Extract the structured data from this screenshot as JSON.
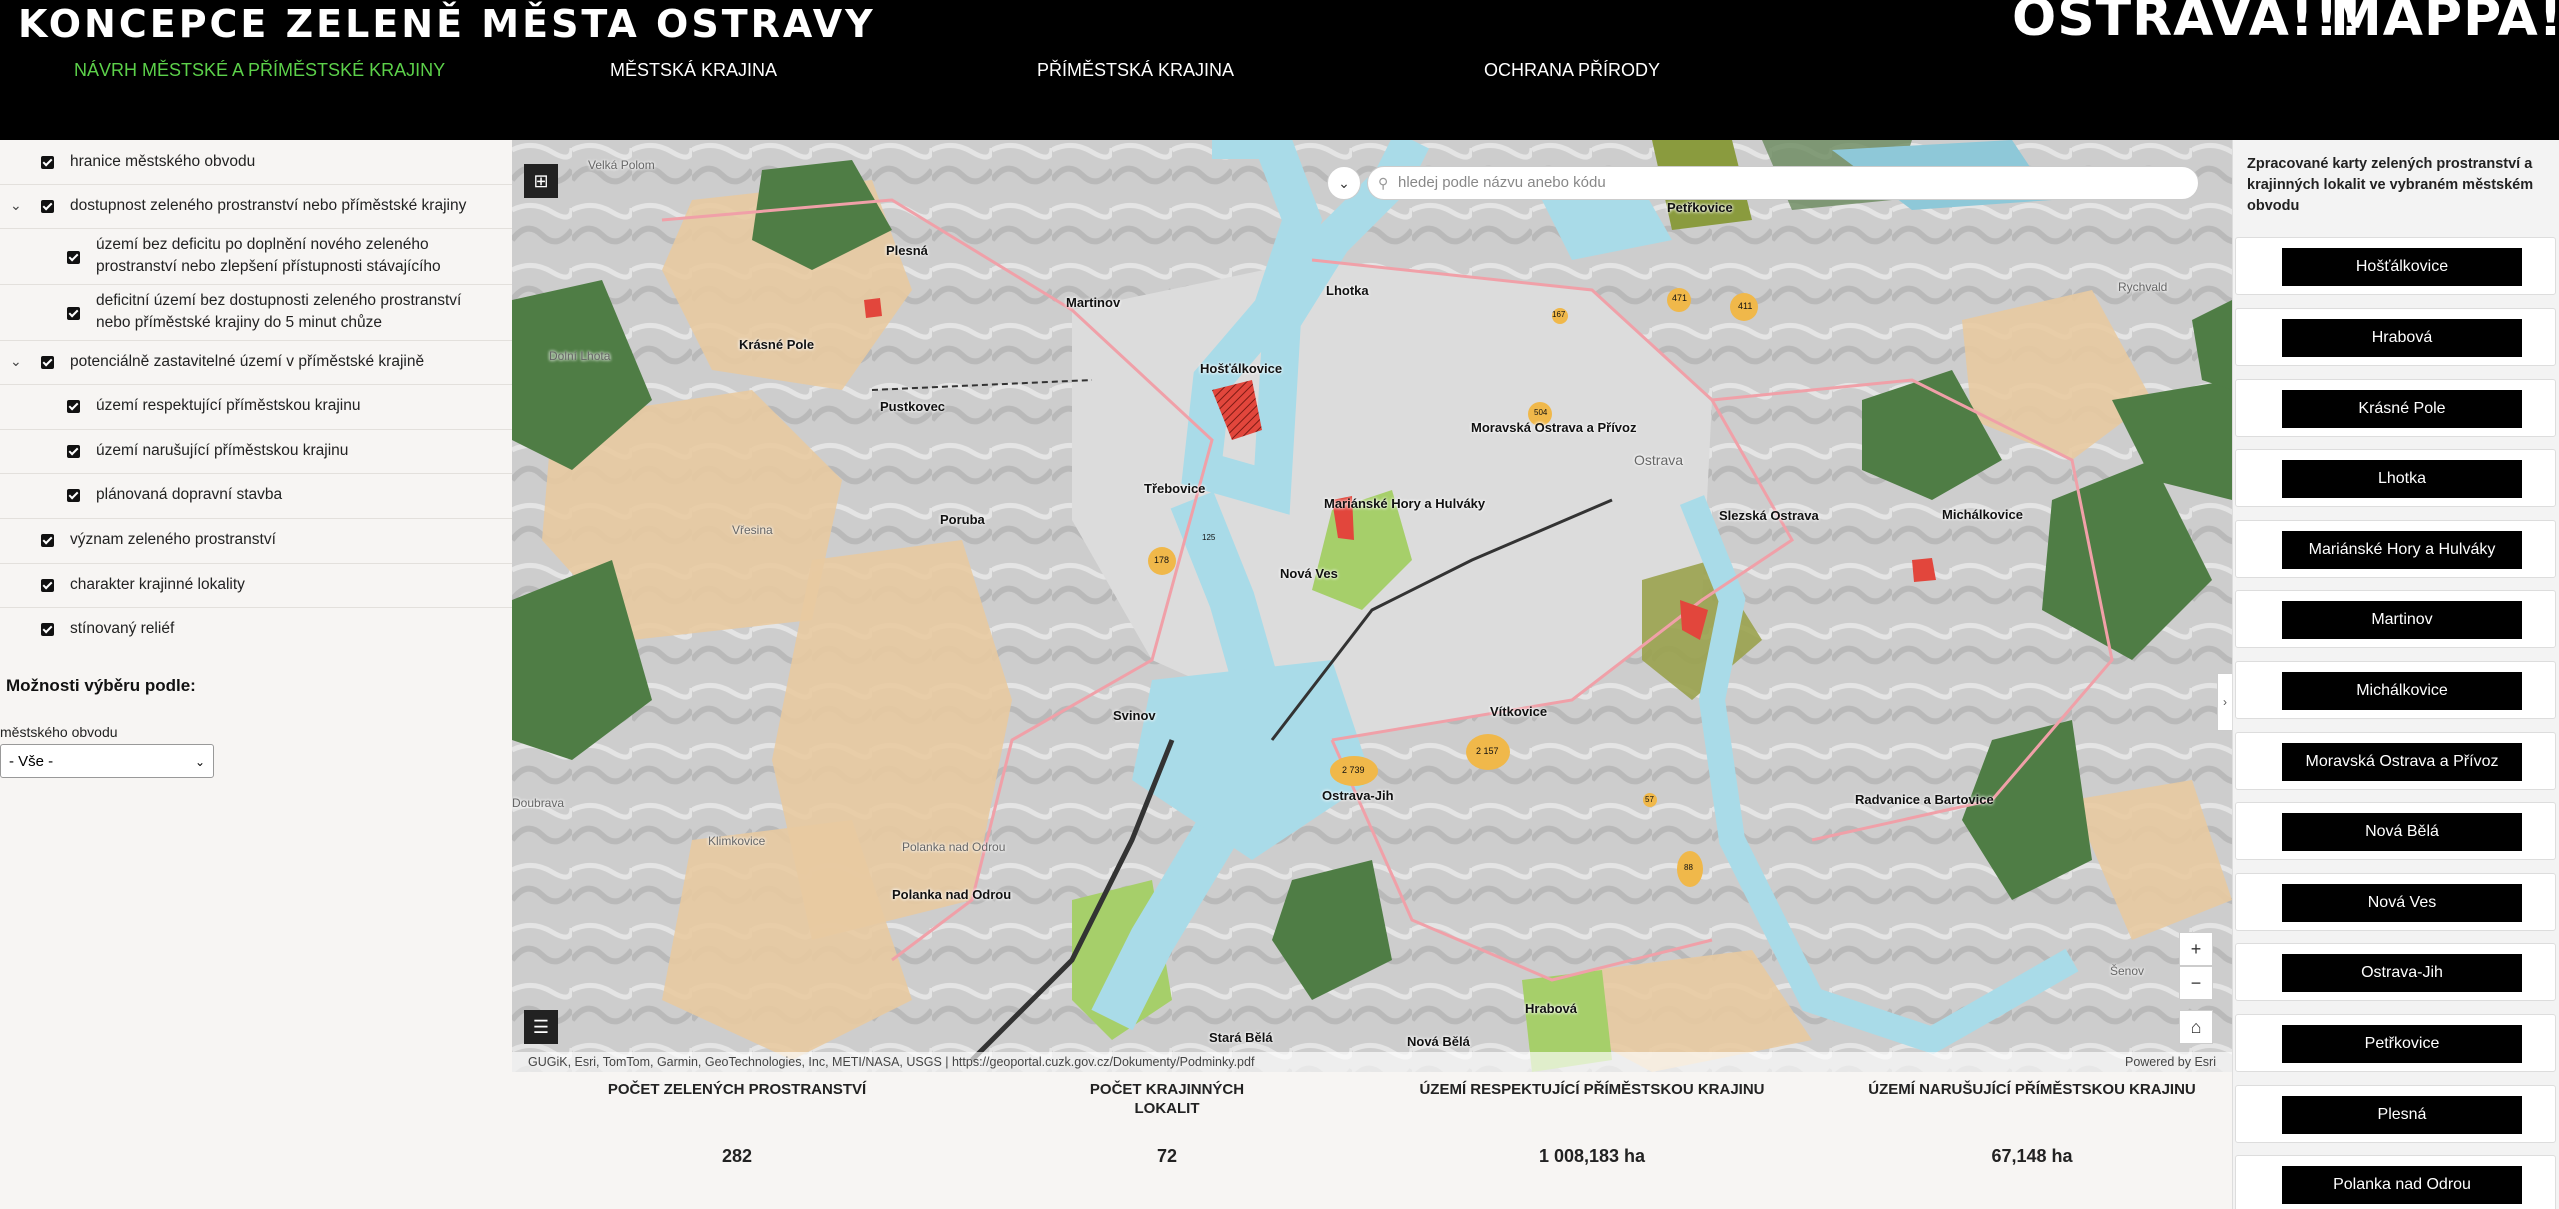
{
  "header": {
    "title": "KONCEPCE ZELENĚ MĚSTA OSTRAVY",
    "brand_1": "OSTRAVA!!!",
    "brand_2": "MAPPA!!!",
    "nav": [
      {
        "label": "NÁVRH MĚSTSKÉ A PŘÍMĚSTSKÉ KRAJINY",
        "active": true
      },
      {
        "label": "MĚSTSKÁ KRAJINA"
      },
      {
        "label": "PŘÍMĚSTSKÁ KRAJINA"
      },
      {
        "label": "OCHRANA PŘÍRODY"
      }
    ]
  },
  "layers": [
    {
      "label": "hranice městského obvodu",
      "checked": true
    },
    {
      "label": "dostupnost zeleného prostranství nebo příměstské krajiny",
      "checked": true,
      "expandable": true
    },
    {
      "label_1": "území bez deficitu po doplnění nového zeleného",
      "label_2": "prostranství nebo zlepšení přístupnosti stávajícího",
      "checked": true
    },
    {
      "label_1": "deficitní území bez dostupnosti zeleného prostranství",
      "label_2": "nebo příměstské krajiny do 5 minut chůze",
      "checked": true
    },
    {
      "label": "potenciálně zastavitelné území v příměstské krajině",
      "checked": true,
      "expandable": true
    },
    {
      "label": "území respektující příměstskou krajinu",
      "checked": true
    },
    {
      "label": "území narušující příměstskou krajinu",
      "checked": true
    },
    {
      "label": "plánovaná dopravní stavba",
      "checked": true
    },
    {
      "label": "význam zeleného prostranství",
      "checked": true
    },
    {
      "label": "charakter krajinné lokality",
      "checked": true
    },
    {
      "label": "stínovaný reliéf",
      "checked": true
    }
  ],
  "filter": {
    "title": "Možnosti výběru podle:",
    "sublabel": "městského obvodu",
    "selected": "- Vše -"
  },
  "map": {
    "search_placeholder": "hledej podle názvu anebo kódu",
    "attribution_left": "GUGiK, Esri, TomTom, Garmin, GeoTechnologies, Inc, METI/NASA, USGS | https://geoportal.cuzk.gov.cz/Dokumenty/Podminky.pdf",
    "attribution_right": "Powered by Esri",
    "labels": [
      "Petřkovice",
      "Plesná",
      "Martinov",
      "Lhotka",
      "Krásné Pole",
      "Hošťálkovice",
      "Pustkovec",
      "Moravská Ostrava a Přívoz",
      "Třebovice",
      "Poruba",
      "Mariánské Hory a Hulváky",
      "Slezská Ostrava",
      "Michálkovice",
      "Nová Ves",
      "Vítkovice",
      "Svinov",
      "Ostrava-Jih",
      "Radvanice a Bartovice",
      "Polanka nad Odrou",
      "Stará Bělá",
      "Nová Bělá",
      "Hrabová"
    ],
    "gray_labels": [
      "Velká Polom",
      "Dolní Lhota",
      "Vřesina",
      "Klimkovice",
      "Polanka nad Odrou",
      "Ostrava",
      "Rychvald",
      "Šenov",
      "Doubrava"
    ],
    "numbers": [
      "471",
      "411",
      "167",
      "178",
      "125",
      "504",
      "2 739",
      "2 157",
      "88",
      "57"
    ]
  },
  "stats": [
    {
      "label_1": "POČET ZELENÝCH PROSTRANSTVÍ",
      "value": "282"
    },
    {
      "label_1": "POČET KRAJINNÝCH",
      "label_2": "LOKALIT",
      "value": "72"
    },
    {
      "label_1": "ÚZEMÍ RESPEKTUJÍCÍ PŘÍMĚSTSKOU KRAJINU",
      "value": "1 008,183 ha"
    },
    {
      "label_1": "ÚZEMÍ NARUŠUJÍCÍ PŘÍMĚSTSKOU KRAJINU",
      "value": "67,148 ha"
    }
  ],
  "right_panel": {
    "header": "Zpracované karty zelených prostranství a krajinných lokalit ve vybraném městském obvodu",
    "districts": [
      "Hošťálkovice",
      "Hrabová",
      "Krásné Pole",
      "Lhotka",
      "Mariánské Hory a Hulváky",
      "Martinov",
      "Michálkovice",
      "Moravská Ostrava a Přívoz",
      "Nová Bělá",
      "Nová Ves",
      "Ostrava-Jih",
      "Petřkovice",
      "Plesná",
      "Polanka nad Odrou"
    ]
  },
  "colors": {
    "nav_active": "#5cd14a",
    "dark_green": "#4f7d45",
    "light_green": "#a6cf6a",
    "tan": "#e8caa1",
    "water": "#a9dbe8",
    "pink_border": "#f0a0a8",
    "red": "#e2463c",
    "orange": "#f0b84a"
  }
}
